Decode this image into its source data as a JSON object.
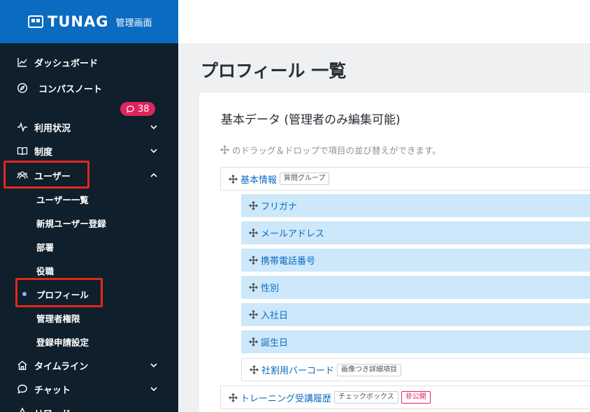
{
  "brand": {
    "name": "TUNAG",
    "subtitle": "管理画面"
  },
  "sidebar": {
    "items": [
      {
        "label": "ダッシュボード",
        "icon": "chart-line-icon"
      },
      {
        "label": "コンパスノート",
        "icon": "compass-icon"
      },
      {
        "label": "利用状況",
        "icon": "activity-icon",
        "chevron": "down"
      },
      {
        "label": "制度",
        "icon": "book-icon",
        "chevron": "down"
      },
      {
        "label": "ユーザー",
        "icon": "users-icon",
        "chevron": "up"
      },
      {
        "label": "タイムライン",
        "icon": "home-icon",
        "chevron": "down"
      },
      {
        "label": "チャット",
        "icon": "chat-icon",
        "chevron": "down"
      },
      {
        "label": "リワード",
        "icon": "reward-icon"
      }
    ],
    "badge": {
      "count": "38",
      "icon": "chat-bubble-icon",
      "color": "#e0245e"
    },
    "user_sub_items": [
      {
        "label": "ユーザー一覧"
      },
      {
        "label": "新規ユーザー登録"
      },
      {
        "label": "部署"
      },
      {
        "label": "役職"
      },
      {
        "label": "プロフィール",
        "active": true
      },
      {
        "label": "管理者権限"
      },
      {
        "label": "登録申請設定"
      }
    ]
  },
  "main": {
    "page_title": "プロフィール 一覧",
    "section_title": "基本データ (管理者のみ編集可能)",
    "hint": "のドラッグ＆ドロップで項目の並び替えができます。",
    "groups": [
      {
        "label": "基本情報",
        "tag": "質問グループ",
        "fields": [
          {
            "label": "フリガナ"
          },
          {
            "label": "メールアドレス"
          },
          {
            "label": "携帯電話番号"
          },
          {
            "label": "性別"
          },
          {
            "label": "入社日"
          },
          {
            "label": "誕生日"
          },
          {
            "label": "社割用バーコード",
            "tag": "画像つき詳細項目"
          }
        ]
      },
      {
        "label": "トレーニング受講履歴",
        "tag": "チェックボックス",
        "private_tag": "非公開"
      }
    ]
  },
  "colors": {
    "brand": "#0a6bc1",
    "sidebar_bg": "#0f1f2b",
    "field_bg": "#cde8fa",
    "highlight": "#e1281d",
    "badge": "#e0245e"
  }
}
